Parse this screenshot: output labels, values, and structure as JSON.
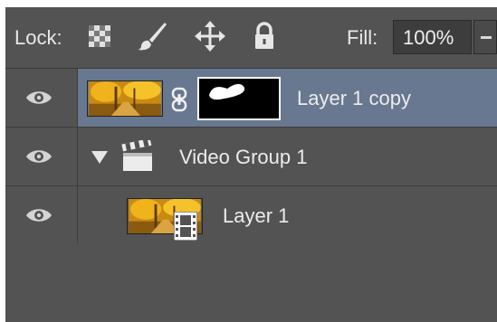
{
  "lock_bar": {
    "lock_label": "Lock:",
    "lock_icons": [
      "lock-transparent-pixels-icon",
      "lock-image-pixels-icon",
      "lock-position-icon",
      "lock-all-icon"
    ],
    "fill_label": "Fill:",
    "fill_value": "100%"
  },
  "layers": [
    {
      "name": "Layer 1 copy",
      "visible": true,
      "selected": true,
      "has_mask": true
    },
    {
      "name": "Video Group 1",
      "visible": true,
      "selected": false,
      "type": "video-group",
      "expanded": true
    },
    {
      "name": "Layer 1",
      "visible": true,
      "selected": false,
      "type": "video-layer"
    }
  ],
  "colors": {
    "panel_bg": "#535353",
    "selected_row": "#687890",
    "text": "#e6e6e6"
  }
}
